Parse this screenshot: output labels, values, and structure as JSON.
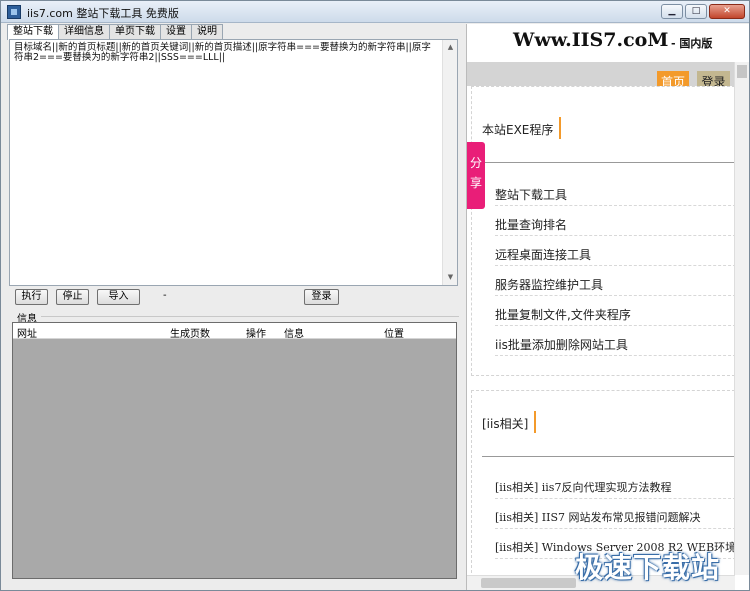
{
  "window": {
    "title": "iis7.com 整站下载工具 免费版",
    "controls": {
      "minimize": "▁",
      "maximize": "□",
      "close": "✕"
    }
  },
  "tabs": [
    {
      "label": "整站下载",
      "active": true
    },
    {
      "label": "详细信息",
      "active": false
    },
    {
      "label": "单页下载",
      "active": false
    },
    {
      "label": "设置",
      "active": false
    },
    {
      "label": "说明",
      "active": false
    }
  ],
  "editor": {
    "text": "目标域名||新的首页标题||新的首页关键词||新的首页描述||原字符串===要替换为的新字符串||原字符串2===要替换为的新字符串2||SSS===LLL||"
  },
  "buttons": {
    "execute": "执行",
    "stop": "停止",
    "import": "导入",
    "dash": "-",
    "login": "登录"
  },
  "info_group": {
    "label": "信息",
    "columns": [
      "网址",
      "生成页数",
      "操作",
      "信息",
      "位置"
    ]
  },
  "web_panel": {
    "brand": "Www.IIS7.coM",
    "brand_sub": "- 国内版",
    "nav": {
      "home": "首页",
      "login": "登录"
    },
    "share": "分享",
    "section1": {
      "title": "本站EXE程序",
      "items": [
        "整站下载工具",
        "批量查询排名",
        "远程桌面连接工具",
        "服务器监控维护工具",
        "批量复制文件,文件夹程序",
        "iis批量添加删除网站工具"
      ]
    },
    "section2": {
      "title": "[iis相关]",
      "items": [
        "[iis相关] iis7反向代理实现方法教程",
        "[iis相关] IIS7 网站发布常见报错问题解决",
        "[iis相关] Windows Server 2008 R2 WEB环境"
      ]
    }
  },
  "watermark": "极速下载站",
  "colors": {
    "accent_orange": "#f39a2b",
    "share_pink": "#e91e78",
    "list_bg": "#a9a9a9"
  }
}
